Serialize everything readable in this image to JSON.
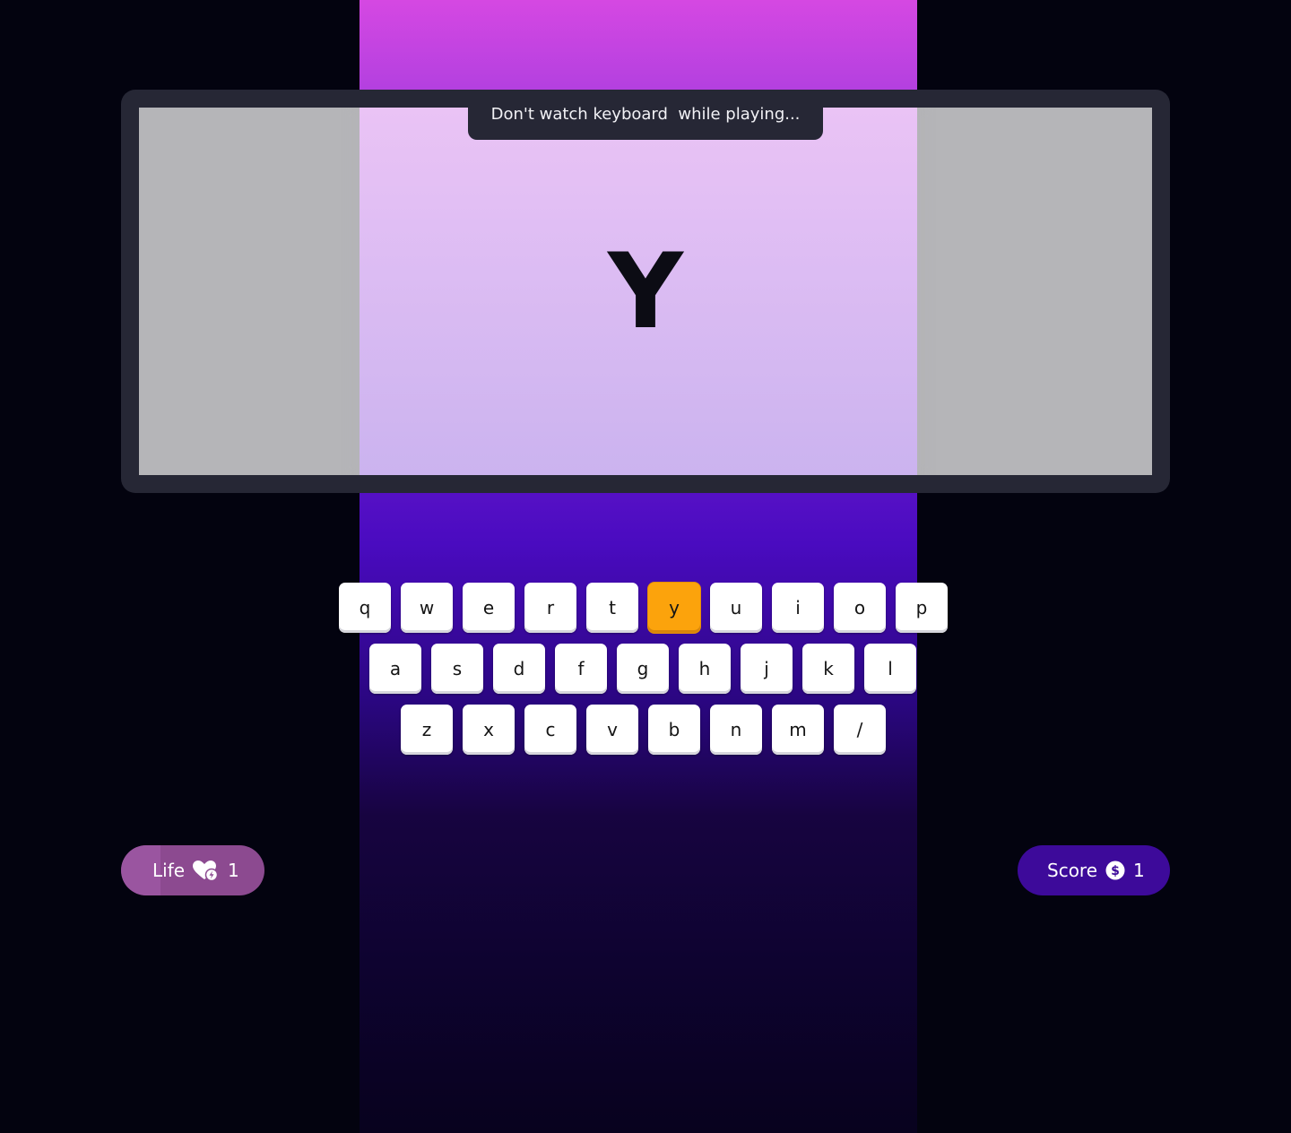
{
  "hint": "Don't watch keyboard  while playing...",
  "target_letter": "Y",
  "keyboard": {
    "rows": [
      [
        "q",
        "w",
        "e",
        "r",
        "t",
        "y",
        "u",
        "i",
        "o",
        "p"
      ],
      [
        "a",
        "s",
        "d",
        "f",
        "g",
        "h",
        "j",
        "k",
        "l"
      ],
      [
        "z",
        "x",
        "c",
        "v",
        "b",
        "n",
        "m",
        "/"
      ]
    ],
    "active_key": "y"
  },
  "life": {
    "label": "Life",
    "icon": "heart-bolt-icon",
    "value": "1"
  },
  "score": {
    "label": "Score",
    "icon": "dollar-coin-icon",
    "value": "1"
  },
  "colors": {
    "active_key": "#fca30c",
    "life_pill": "#8c4a90",
    "score_pill": "#3d0a9a",
    "frame": "#262735"
  }
}
